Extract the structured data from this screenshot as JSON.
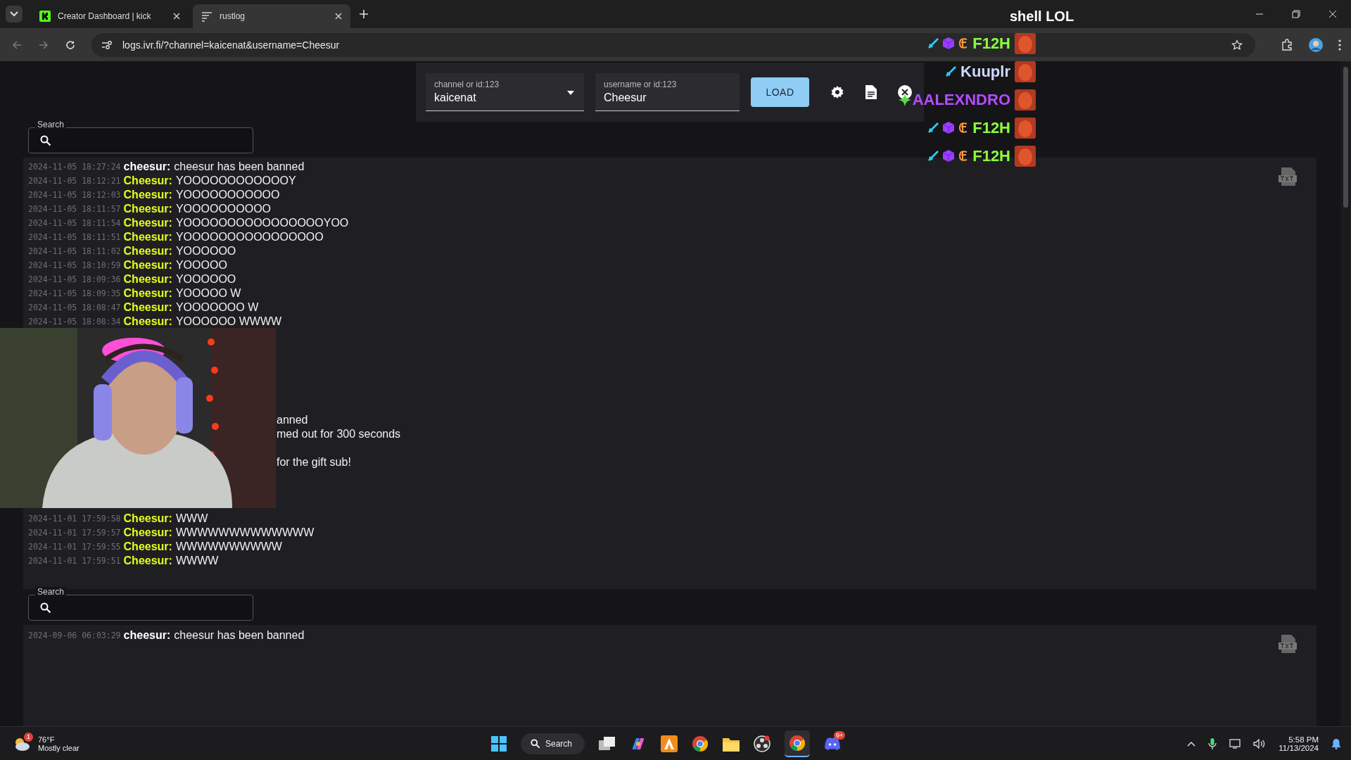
{
  "browser": {
    "tabs": [
      {
        "title": "Creator Dashboard | kick",
        "kind": "kick",
        "selected": false
      },
      {
        "title": "rustlog",
        "kind": "lines",
        "selected": true
      }
    ],
    "url": "logs.ivr.fi/?channel=kaicenat&username=Cheesur"
  },
  "controls": {
    "channel": {
      "label": "channel or id:123",
      "value": "kaicenat"
    },
    "username": {
      "label": "username or id:123",
      "value": "Cheesur"
    },
    "load": "LOAD"
  },
  "logs": [
    {
      "search": {
        "label": "Search"
      },
      "lines": [
        {
          "time": "2024-11-05 18:27:24",
          "user": "cheesur:",
          "kind": "system",
          "text": "cheesur has been banned"
        },
        {
          "time": "2024-11-05 18:12:21",
          "user": "Cheesur:",
          "kind": "chat",
          "text": "YOOOOOOOOOOOOY"
        },
        {
          "time": "2024-11-05 18:12:03",
          "user": "Cheesur:",
          "kind": "chat",
          "text": "YOOOOOOOOOOO"
        },
        {
          "time": "2024-11-05 18:11:57",
          "user": "Cheesur:",
          "kind": "chat",
          "text": "YOOOOOOOOOO"
        },
        {
          "time": "2024-11-05 18:11:54",
          "user": "Cheesur:",
          "kind": "chat",
          "text": "YOOOOOOOOOOOOOOOOYOO"
        },
        {
          "time": "2024-11-05 18:11:51",
          "user": "Cheesur:",
          "kind": "chat",
          "text": "YOOOOOOOOOOOOOOOO"
        },
        {
          "time": "2024-11-05 18:11:02",
          "user": "Cheesur:",
          "kind": "chat",
          "text": "YOOOOOO"
        },
        {
          "time": "2024-11-05 18:10:59",
          "user": "Cheesur:",
          "kind": "chat",
          "text": "YOOOOO"
        },
        {
          "time": "2024-11-05 18:09:36",
          "user": "Cheesur:",
          "kind": "chat",
          "text": "YOOOOOO"
        },
        {
          "time": "2024-11-05 18:09:35",
          "user": "Cheesur:",
          "kind": "chat",
          "text": "YOOOOO W"
        },
        {
          "time": "2024-11-05 18:08:47",
          "user": "Cheesur:",
          "kind": "chat",
          "text": "YOOOOOOO W"
        },
        {
          "time": "2024-11-05 18:08:34",
          "user": "Cheesur:",
          "kind": "chat",
          "text": "YOOOOOO WWWW"
        }
      ],
      "covered_tails": [
        {
          "text": "anned"
        },
        {
          "text": "med out for 300 seconds"
        },
        {
          "text": "for the gift sub!"
        }
      ],
      "lines_after": [
        {
          "time": "2024-11-01 17:59:58",
          "user": "Cheesur:",
          "kind": "chat",
          "text": "WWW"
        },
        {
          "time": "2024-11-01 17:59:57",
          "user": "Cheesur:",
          "kind": "chat",
          "text": "WWWWWWWWWWWWW"
        },
        {
          "time": "2024-11-01 17:59:55",
          "user": "Cheesur:",
          "kind": "chat",
          "text": "WWWWWWWWWW"
        },
        {
          "time": "2024-11-01 17:59:51",
          "user": "Cheesur:",
          "kind": "chat",
          "text": "WWWW"
        }
      ]
    },
    {
      "search": {
        "label": "Search"
      },
      "lines": [
        {
          "time": "2024-09-06 06:03:29",
          "user": "cheesur:",
          "kind": "system",
          "text": "cheesur has been banned"
        }
      ]
    }
  ],
  "stream_chat": {
    "partial_text": "shell LOL",
    "messages": [
      {
        "name": "F12H",
        "color": "#8cff3c",
        "badges": [
          {
            "kind": "sword"
          },
          {
            "kind": "cube"
          },
          {
            "kind": "coin"
          }
        ]
      },
      {
        "name": "Kuuplr",
        "color": "#cdd9ff",
        "badges": [
          {
            "kind": "sword"
          }
        ]
      },
      {
        "name": "AALEXNDRO",
        "color": "#b44cff",
        "badges": [
          {
            "kind": "sparkle"
          }
        ]
      },
      {
        "name": "F12H",
        "color": "#8cff3c",
        "badges": [
          {
            "kind": "sword"
          },
          {
            "kind": "cube"
          },
          {
            "kind": "coin"
          }
        ]
      },
      {
        "name": "F12H",
        "color": "#8cff3c",
        "badges": [
          {
            "kind": "sword"
          },
          {
            "kind": "cube"
          },
          {
            "kind": "coin"
          }
        ]
      }
    ]
  },
  "taskbar": {
    "weather": {
      "badge": "1",
      "temp": "76°F",
      "condition": "Mostly clear"
    },
    "search": "Search",
    "discord_badge": "9+",
    "time": "5:58 PM",
    "date": "11/13/2024"
  }
}
